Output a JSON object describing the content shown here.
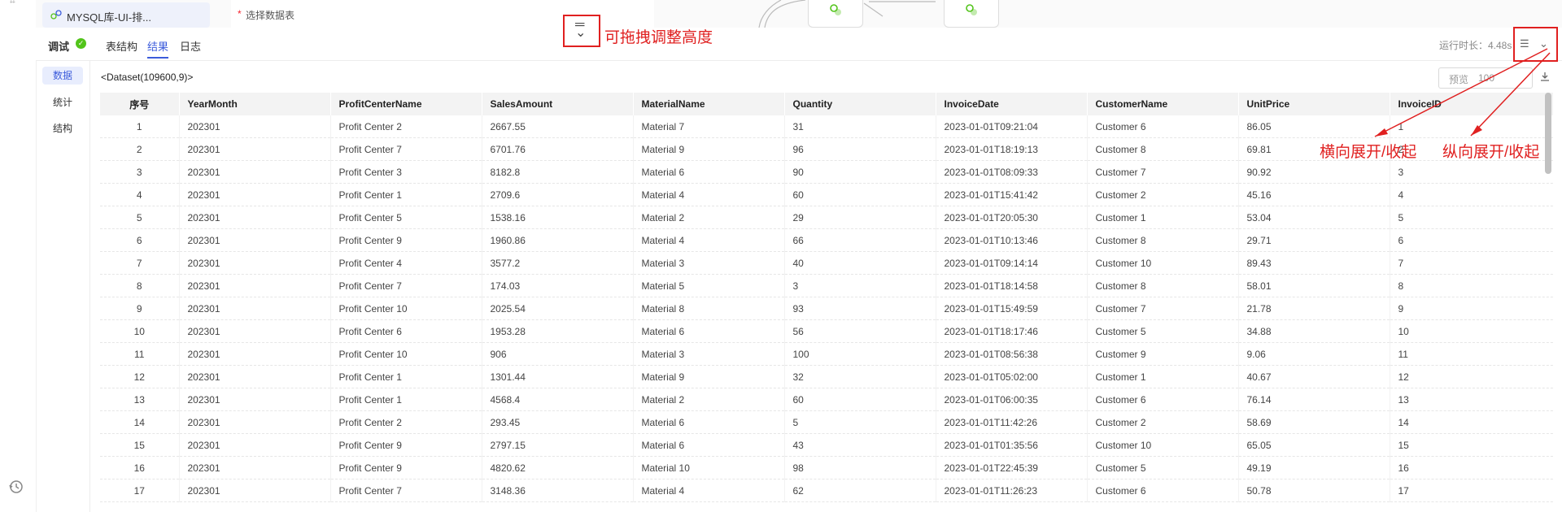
{
  "canvas": {
    "node_label": "MYSQL库-UI-排...",
    "select_table_label": "选择数据表",
    "required_mark": "*"
  },
  "annotations": {
    "drag": "可拖拽调整高度",
    "horizontal": "横向展开/收起",
    "vertical": "纵向展开/收起"
  },
  "panel": {
    "debug_label": "调试",
    "tabs": [
      {
        "label": "表结构",
        "active": false
      },
      {
        "label": "结果",
        "active": true
      },
      {
        "label": "日志",
        "active": false
      }
    ],
    "runtime": "运行时长：4.48s",
    "side_menu": [
      {
        "label": "数据",
        "active": true
      },
      {
        "label": "统计",
        "active": false
      },
      {
        "label": "结构",
        "active": false
      }
    ],
    "dataset_label": "<Dataset(109600,9)>",
    "preview_label": "预览",
    "preview_value": "100"
  },
  "icons": {
    "accent": "#3b5bdb",
    "annotation": "#e02020",
    "success": "#52c41a"
  },
  "table": {
    "columns": [
      "序号",
      "YearMonth",
      "ProfitCenterName",
      "SalesAmount",
      "MaterialName",
      "Quantity",
      "InvoiceDate",
      "CustomerName",
      "UnitPrice",
      "InvoiceID"
    ],
    "rows": [
      [
        "1",
        "202301",
        "Profit Center 2",
        "2667.55",
        "Material 7",
        "31",
        "2023-01-01T09:21:04",
        "Customer 6",
        "86.05",
        "1"
      ],
      [
        "2",
        "202301",
        "Profit Center 7",
        "6701.76",
        "Material 9",
        "96",
        "2023-01-01T18:19:13",
        "Customer 8",
        "69.81",
        "2"
      ],
      [
        "3",
        "202301",
        "Profit Center 3",
        "8182.8",
        "Material 6",
        "90",
        "2023-01-01T08:09:33",
        "Customer 7",
        "90.92",
        "3"
      ],
      [
        "4",
        "202301",
        "Profit Center 1",
        "2709.6",
        "Material 4",
        "60",
        "2023-01-01T15:41:42",
        "Customer 2",
        "45.16",
        "4"
      ],
      [
        "5",
        "202301",
        "Profit Center 5",
        "1538.16",
        "Material 2",
        "29",
        "2023-01-01T20:05:30",
        "Customer 1",
        "53.04",
        "5"
      ],
      [
        "6",
        "202301",
        "Profit Center 9",
        "1960.86",
        "Material 4",
        "66",
        "2023-01-01T10:13:46",
        "Customer 8",
        "29.71",
        "6"
      ],
      [
        "7",
        "202301",
        "Profit Center 4",
        "3577.2",
        "Material 3",
        "40",
        "2023-01-01T09:14:14",
        "Customer 10",
        "89.43",
        "7"
      ],
      [
        "8",
        "202301",
        "Profit Center 7",
        "174.03",
        "Material 5",
        "3",
        "2023-01-01T18:14:58",
        "Customer 8",
        "58.01",
        "8"
      ],
      [
        "9",
        "202301",
        "Profit Center 10",
        "2025.54",
        "Material 8",
        "93",
        "2023-01-01T15:49:59",
        "Customer 7",
        "21.78",
        "9"
      ],
      [
        "10",
        "202301",
        "Profit Center 6",
        "1953.28",
        "Material 6",
        "56",
        "2023-01-01T18:17:46",
        "Customer 5",
        "34.88",
        "10"
      ],
      [
        "11",
        "202301",
        "Profit Center 10",
        "906",
        "Material 3",
        "100",
        "2023-01-01T08:56:38",
        "Customer 9",
        "9.06",
        "11"
      ],
      [
        "12",
        "202301",
        "Profit Center 1",
        "1301.44",
        "Material 9",
        "32",
        "2023-01-01T05:02:00",
        "Customer 1",
        "40.67",
        "12"
      ],
      [
        "13",
        "202301",
        "Profit Center 1",
        "4568.4",
        "Material 2",
        "60",
        "2023-01-01T06:00:35",
        "Customer 6",
        "76.14",
        "13"
      ],
      [
        "14",
        "202301",
        "Profit Center 2",
        "293.45",
        "Material 6",
        "5",
        "2023-01-01T11:42:26",
        "Customer 2",
        "58.69",
        "14"
      ],
      [
        "15",
        "202301",
        "Profit Center 9",
        "2797.15",
        "Material 6",
        "43",
        "2023-01-01T01:35:56",
        "Customer 10",
        "65.05",
        "15"
      ],
      [
        "16",
        "202301",
        "Profit Center 9",
        "4820.62",
        "Material 10",
        "98",
        "2023-01-01T22:45:39",
        "Customer 5",
        "49.19",
        "16"
      ],
      [
        "17",
        "202301",
        "Profit Center 7",
        "3148.36",
        "Material 4",
        "62",
        "2023-01-01T11:26:23",
        "Customer 6",
        "50.78",
        "17"
      ]
    ]
  }
}
